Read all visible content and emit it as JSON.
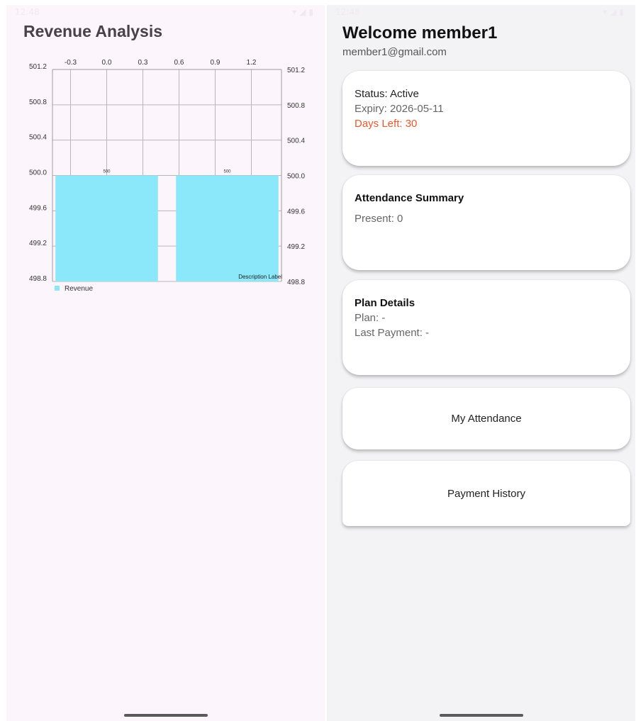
{
  "left_screen": {
    "status_bar": {
      "time": "12:48",
      "icons": "▾◢▮"
    },
    "title": "Revenue Analysis"
  },
  "right_screen": {
    "status_bar": {
      "time": "12:48",
      "icons": "▾◢▮"
    },
    "welcome_title": "Welcome member1",
    "email": "member1@gmail.com",
    "status_card": {
      "status": "Status: Active",
      "expiry": "Expiry: 2026-05-11",
      "days_left": "Days Left: 30"
    },
    "attendance_card": {
      "title": "Attendance Summary",
      "present": "Present: 0"
    },
    "plan_card": {
      "title": "Plan Details",
      "plan": "Plan: -",
      "last_payment": "Last Payment: -"
    },
    "buttons": {
      "my_attendance": "My Attendance",
      "payment_history": "Payment History"
    }
  },
  "colors": {
    "bar": "#8be7fa",
    "grid": "#b9b6bb",
    "warn": "#f0562a"
  },
  "chart_data": {
    "type": "bar",
    "x": [
      0,
      1
    ],
    "values": [
      500,
      500
    ],
    "value_labels": [
      "500",
      "500"
    ],
    "x_ticks": [
      "-0.3",
      "0.0",
      "0.3",
      "0.6",
      "0.9",
      "1.2"
    ],
    "x_tick_values": [
      -0.3,
      0.0,
      0.3,
      0.6,
      0.9,
      1.2
    ],
    "xlim": [
      -0.45,
      1.45
    ],
    "y_ticks": [
      "501.2",
      "500.8",
      "500.4",
      "500.0",
      "499.6",
      "499.2",
      "498.8"
    ],
    "y_tick_values": [
      501.2,
      500.8,
      500.4,
      500.0,
      499.6,
      499.2,
      498.8
    ],
    "ylim": [
      498.8,
      501.2
    ],
    "bar_width": 0.85,
    "series": [
      {
        "name": "Revenue",
        "values": [
          500,
          500
        ]
      }
    ],
    "description": "Description Label",
    "grid": true,
    "legend": "bottom-left"
  }
}
